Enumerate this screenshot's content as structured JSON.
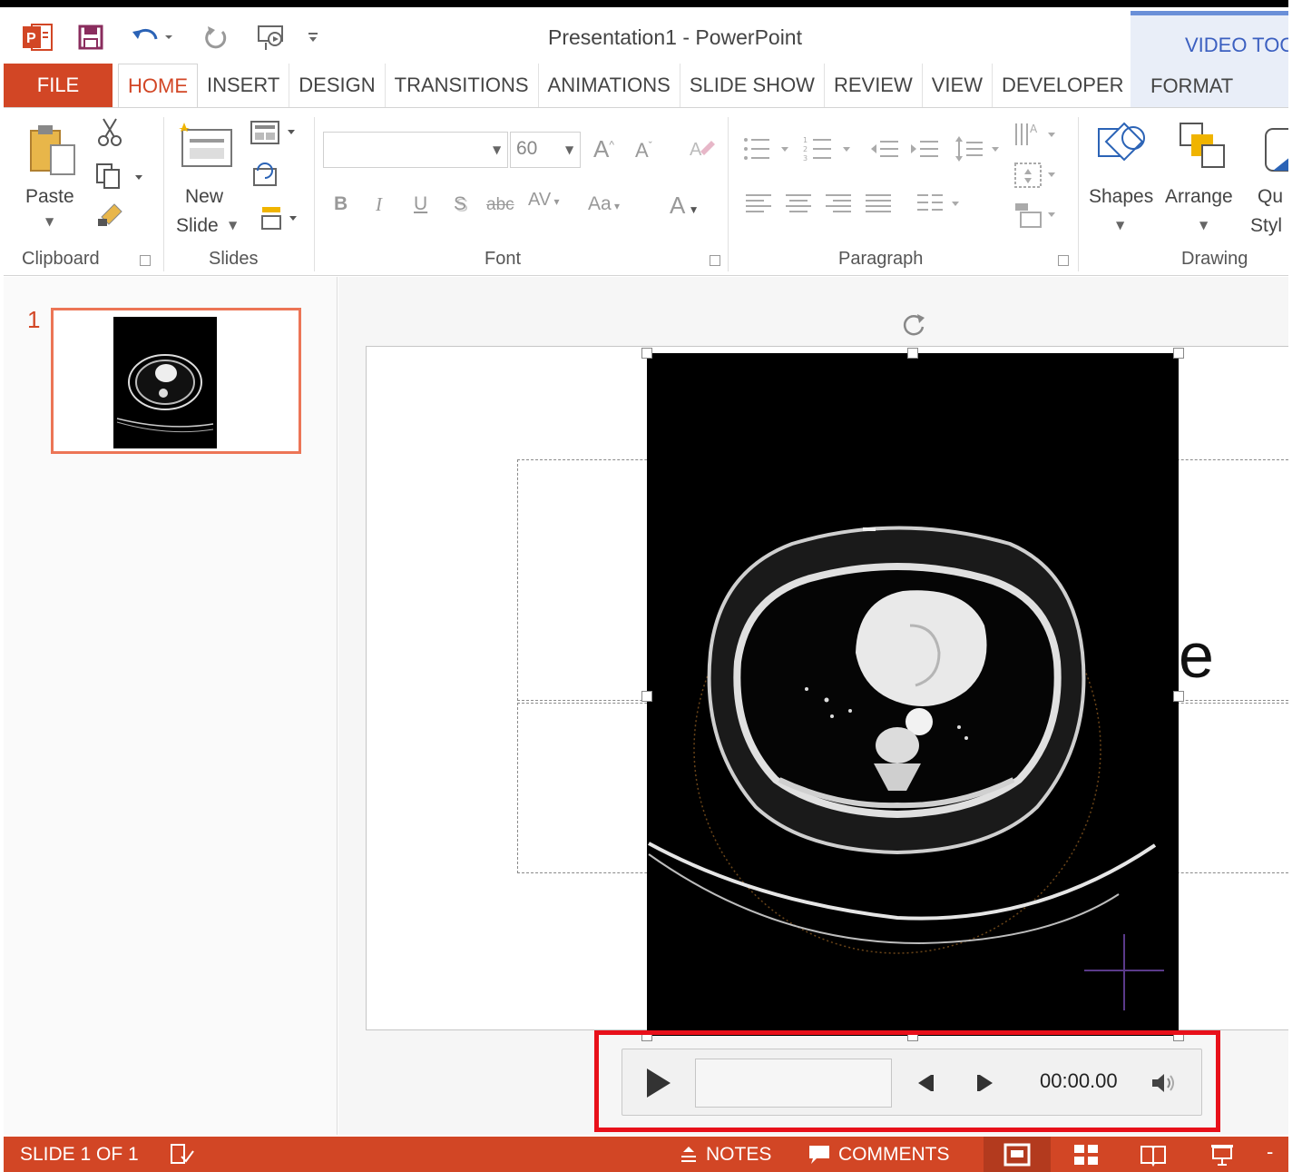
{
  "window": {
    "title": "Presentation1 - PowerPoint"
  },
  "contextual": {
    "group_label": "VIDEO TOO",
    "tab_label": "FORMAT"
  },
  "tabs": [
    "HOME",
    "INSERT",
    "DESIGN",
    "TRANSITIONS",
    "ANIMATIONS",
    "SLIDE SHOW",
    "REVIEW",
    "VIEW",
    "DEVELOPER"
  ],
  "file_tab": "FILE",
  "ribbon": {
    "clipboard": {
      "label": "Clipboard",
      "paste": "Paste"
    },
    "slides": {
      "label": "Slides",
      "new_slide_line1": "New",
      "new_slide_line2": "Slide"
    },
    "font": {
      "label": "Font",
      "size_value": "60"
    },
    "paragraph": {
      "label": "Paragraph"
    },
    "drawing": {
      "label": "Drawing",
      "shapes": "Shapes",
      "arrange": "Arrange",
      "quick_styles_line1": "Qu",
      "quick_styles_line2": "Styl"
    }
  },
  "thumbnails": [
    {
      "number": "1"
    }
  ],
  "slide": {
    "placeholder_visible_text": "e"
  },
  "player": {
    "time": "00:00.00"
  },
  "status": {
    "slide_info": "SLIDE 1 OF 1",
    "notes": "NOTES",
    "comments": "COMMENTS"
  },
  "colors": {
    "accent": "#d24625",
    "highlight_box": "#e8101a",
    "contextual_blue": "#3b5fc0"
  }
}
